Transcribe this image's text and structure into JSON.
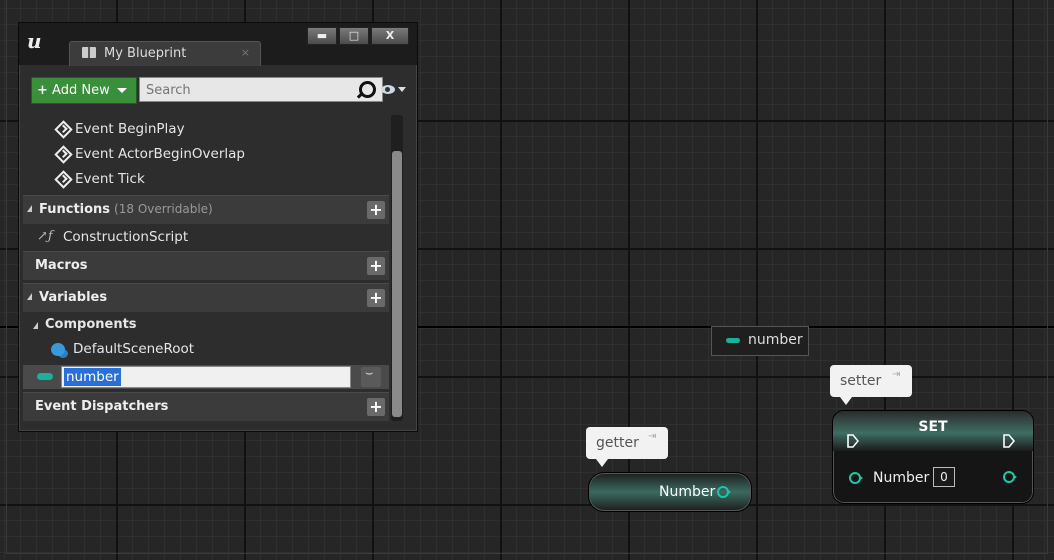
{
  "window": {
    "title_tab": "My Blueprint",
    "logo_text": "u",
    "close_tab_glyph": "×",
    "minimize_glyph": "▬",
    "maximize_glyph": "□",
    "close_glyph": "X"
  },
  "toolbar": {
    "add_new_label": "Add New",
    "add_new_plus": "+",
    "search_placeholder": "Search"
  },
  "events": [
    {
      "label": "Event BeginPlay",
      "icon": "event-diamond-icon"
    },
    {
      "label": "Event ActorBeginOverlap",
      "icon": "event-diamond-icon"
    },
    {
      "label": "Event Tick",
      "icon": "event-diamond-icon"
    }
  ],
  "functions": {
    "label": "Functions",
    "overridable": "(18 Overridable)",
    "items": [
      {
        "label": "ConstructionScript",
        "icon": "function-icon"
      }
    ]
  },
  "macros": {
    "label": "Macros"
  },
  "variables": {
    "label": "Variables",
    "components_label": "Components",
    "components": [
      {
        "label": "DefaultSceneRoot",
        "icon": "scene-component-icon"
      }
    ],
    "selected_variable": "number"
  },
  "event_dispatchers": {
    "label": "Event Dispatchers"
  },
  "graph": {
    "drag_tooltip": "number",
    "getter_comment": "getter",
    "setter_comment": "setter",
    "getter_node": {
      "pin_label": "Number"
    },
    "set_node": {
      "title": "SET",
      "pin_label": "Number",
      "default_value": "0"
    },
    "pin_color": "#17c9a8"
  }
}
